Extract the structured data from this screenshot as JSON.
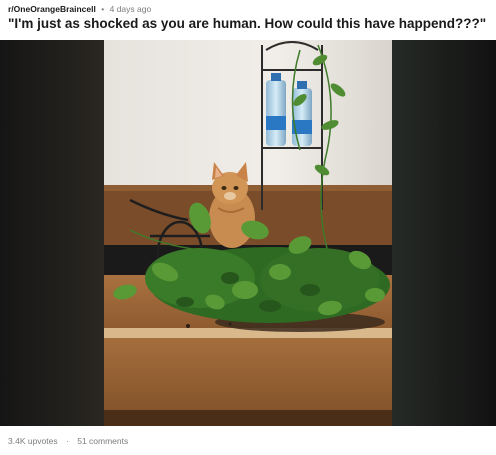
{
  "post": {
    "subreddit": "r/OneOrangeBraincell",
    "separator": "•",
    "time_ago": "4 days ago",
    "title": "\"I'm just as shocked as you are human. How could this have happend???\"",
    "image_alt": "Orange cat sitting behind a knocked-over pothos plant spilled on a wooden desk",
    "stats": {
      "upvotes": "3.4K upvotes",
      "separator": "·",
      "comments": "51 comments"
    }
  }
}
